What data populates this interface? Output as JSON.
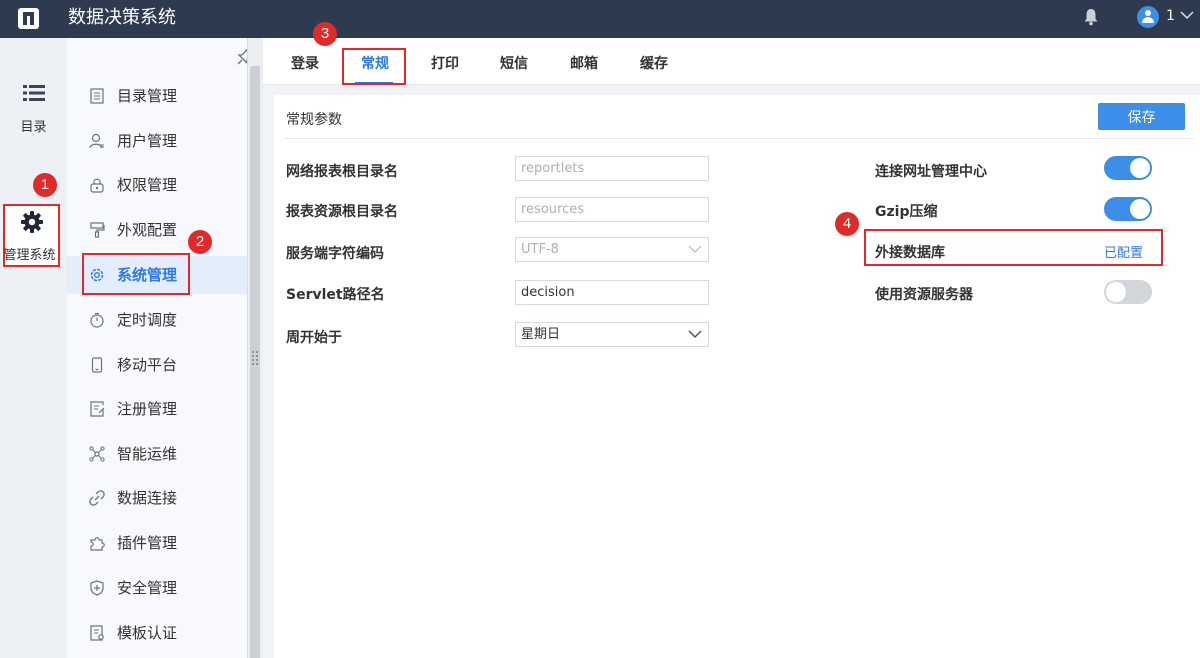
{
  "app": {
    "title": "数据决策系统",
    "user": "1"
  },
  "rail": {
    "catalog": "目录",
    "system": "管理系统"
  },
  "nav": {
    "items": [
      {
        "label": "目录管理"
      },
      {
        "label": "用户管理"
      },
      {
        "label": "权限管理"
      },
      {
        "label": "外观配置"
      },
      {
        "label": "系统管理"
      },
      {
        "label": "定时调度"
      },
      {
        "label": "移动平台"
      },
      {
        "label": "注册管理"
      },
      {
        "label": "智能运维"
      },
      {
        "label": "数据连接"
      },
      {
        "label": "插件管理"
      },
      {
        "label": "安全管理"
      },
      {
        "label": "模板认证"
      }
    ]
  },
  "tabs": [
    {
      "label": "登录"
    },
    {
      "label": "常规"
    },
    {
      "label": "打印"
    },
    {
      "label": "短信"
    },
    {
      "label": "邮箱"
    },
    {
      "label": "缓存"
    }
  ],
  "panel": {
    "title": "常规参数",
    "save": "保存",
    "left": [
      {
        "label": "网络报表根目录名",
        "value": "reportlets"
      },
      {
        "label": "报表资源根目录名",
        "value": "resources"
      },
      {
        "label": "服务端字符编码",
        "value": "UTF-8"
      },
      {
        "label": "Servlet路径名",
        "value": "decision"
      },
      {
        "label": "周开始于",
        "value": "星期日"
      }
    ],
    "right": [
      {
        "label": "连接网址管理中心",
        "on": true
      },
      {
        "label": "Gzip压缩",
        "on": true
      },
      {
        "label": "外接数据库",
        "value": "已配置"
      },
      {
        "label": "使用资源服务器",
        "on": false
      }
    ]
  },
  "badges": [
    "1",
    "2",
    "3",
    "4"
  ]
}
